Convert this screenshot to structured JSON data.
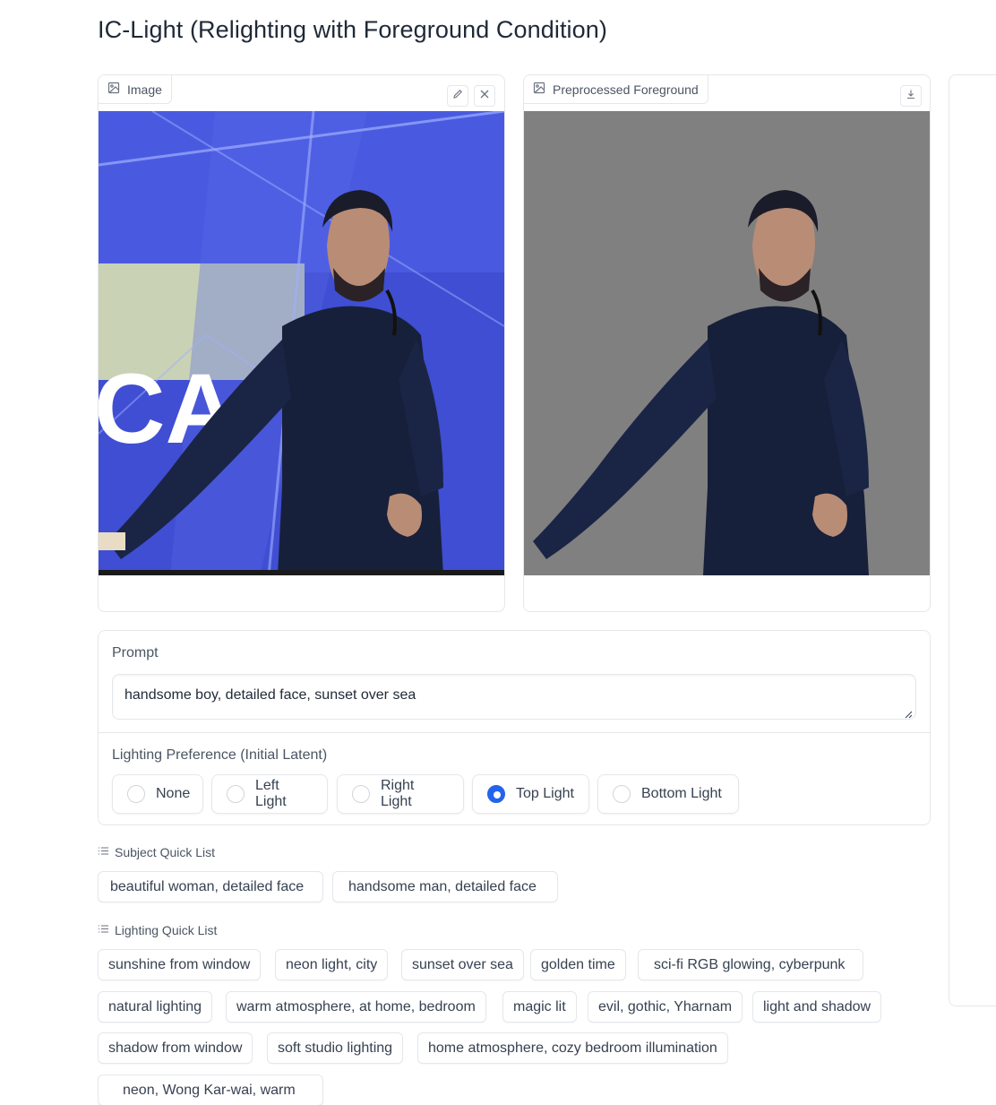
{
  "title": "IC-Light (Relighting with Foreground Condition)",
  "input_image": {
    "label": "Image",
    "icon": "image-icon",
    "edit_icon": "pencil-icon",
    "clear_icon": "close-icon"
  },
  "foreground_image": {
    "label": "Preprocessed Foreground",
    "icon": "image-icon",
    "download_icon": "download-icon"
  },
  "prompt": {
    "label": "Prompt",
    "value": "handsome boy, detailed face, sunset over sea"
  },
  "lighting": {
    "label": "Lighting Preference (Initial Latent)",
    "options": [
      "None",
      "Left Light",
      "Right Light",
      "Top Light",
      "Bottom Light"
    ],
    "selected": "Top Light"
  },
  "subject_quick_list": {
    "label": "Subject Quick List",
    "items": [
      "beautiful woman, detailed face",
      "handsome man, detailed face"
    ]
  },
  "lighting_quick_list": {
    "label": "Lighting Quick List",
    "items": [
      "sunshine from window",
      "neon light, city",
      "sunset over sea",
      "golden time",
      "sci-fi RGB glowing, cyberpunk",
      "natural lighting",
      "warm atmosphere, at home, bedroom",
      "magic lit",
      "evil, gothic, Yharnam",
      "light and shadow",
      "shadow from window",
      "soft studio lighting",
      "home atmosphere, cozy bedroom illumination",
      "neon, Wong Kar-wai, warm"
    ]
  },
  "colors": {
    "accent": "#2563eb",
    "border": "#e5e7eb",
    "photo_bg_blue": "#3f4fd8",
    "foreground_bg_gray": "#808080"
  }
}
